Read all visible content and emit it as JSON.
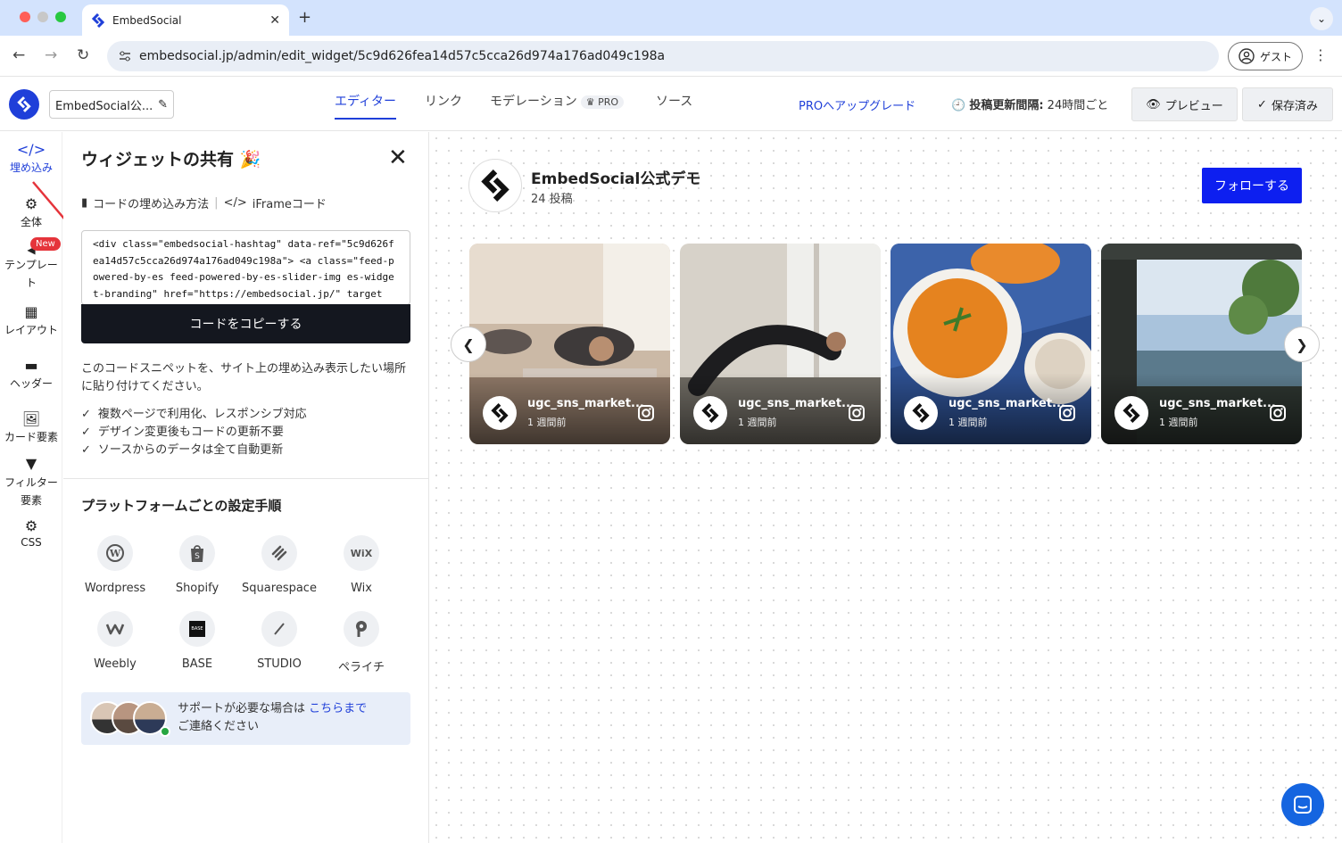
{
  "browser": {
    "tab_title": "EmbedSocial",
    "url": "embedsocial.jp/admin/edit_widget/5c9d626fea14d57c5cca26d974a176ad049c198a",
    "guest_label": "ゲスト"
  },
  "header": {
    "widget_name": "EmbedSocial公...",
    "tabs": [
      "エディター",
      "リンク",
      "モデレーション",
      "ソース"
    ],
    "pro_badge": "PRO",
    "upgrade": "PROへアップグレード",
    "interval_label": "投稿更新間隔:",
    "interval_value": "24時間ごと",
    "preview_btn": "プレビュー",
    "saved_btn": "保存済み"
  },
  "leftnav": {
    "items": [
      "埋め込み",
      "全体",
      "テンプレート",
      "レイアウト",
      "ヘッダー",
      "カード要素",
      "フィルター要素",
      "CSS"
    ],
    "new_badge": "New"
  },
  "panel": {
    "title": "ウィジェットの共有 🎉",
    "link_howto": "コードの埋め込み方法",
    "link_iframe": "iFrameコード",
    "code": "<div class=\"embedsocial-hashtag\" data-ref=\"5c9d626fea14d57c5cca26d974a176ad049c198a\"> <a class=\"feed-powered-by-es feed-powered-by-es-slider-img es-widget-branding\" href=\"https://embedsocial.jp/\" target=\"_blank\" title=\"Embed",
    "copy_btn": "コードをコピーする",
    "description": "このコードスニペットを、サイト上の埋め込み表示したい場所に貼り付けてください。",
    "checks": [
      "複数ページで利用化、レスポンシブ対応",
      "デザイン変更後もコードの更新不要",
      "ソースからのデータは全て自動更新"
    ],
    "platform_title": "プラットフォームごとの設定手順",
    "platforms": [
      "Wordpress",
      "Shopify",
      "Squarespace",
      "Wix",
      "Weebly",
      "BASE",
      "STUDIO",
      "ペライチ"
    ],
    "support_text": "サポートが必要な場合は",
    "support_link": "こちらまで",
    "support_text2": "ご連絡ください"
  },
  "preview": {
    "account_name": "EmbedSocial公式デモ",
    "post_count": "24 投稿",
    "follow_btn": "フォローする",
    "cards": [
      {
        "user": "ugc_sns_market...",
        "time": "1 週間前"
      },
      {
        "user": "ugc_sns_market...",
        "time": "1 週間前"
      },
      {
        "user": "ugc_sns_market...",
        "time": "1 週間前"
      },
      {
        "user": "ugc_sns_market...",
        "time": "1 週間前"
      }
    ]
  },
  "colors": {
    "accent": "#1f3fd9",
    "follow": "#0d1ff0",
    "copy_button": "#14171f",
    "badge_red": "#e5343b"
  }
}
